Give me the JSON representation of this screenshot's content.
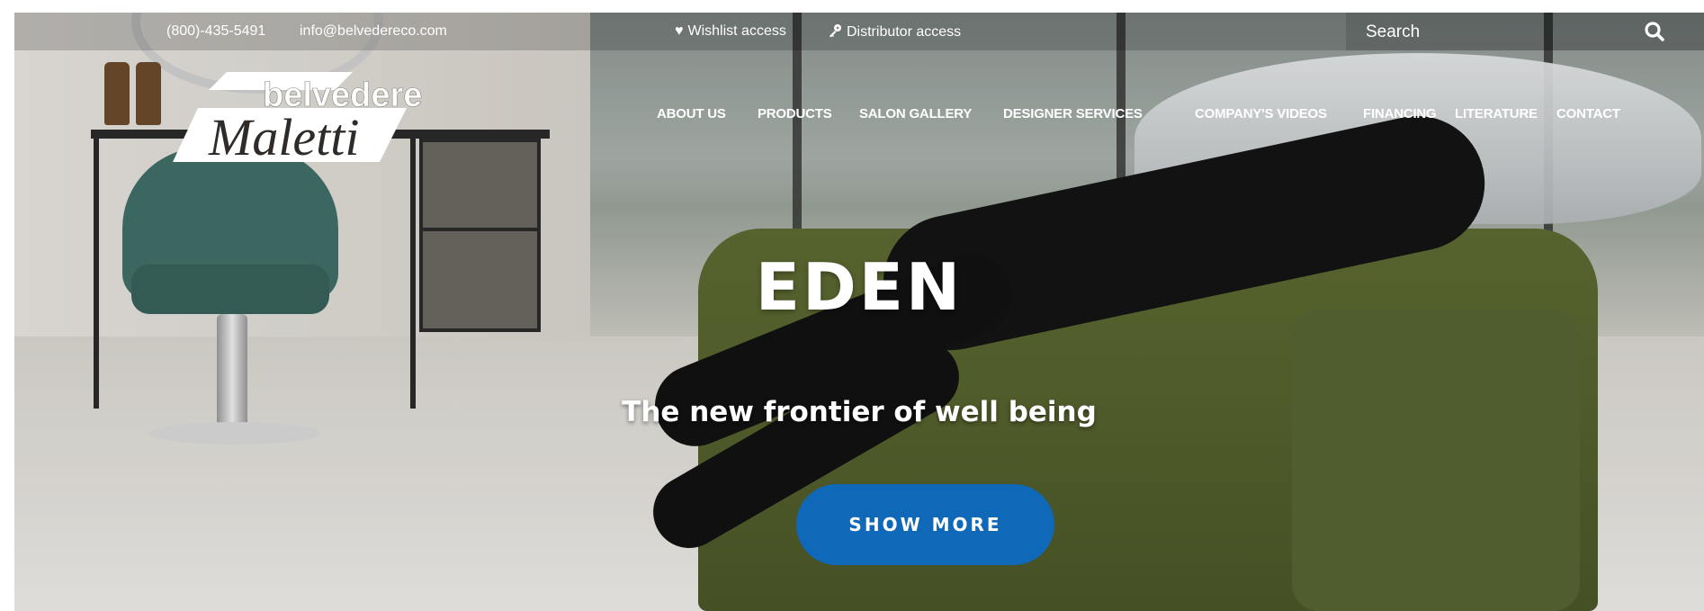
{
  "topbar": {
    "phone": "(800)-435-5491",
    "email": "info@belvedereco.com",
    "wishlist_label": "Wishlist access",
    "distributor_label": "Distributor access",
    "wishlist_icon": "heart-icon",
    "distributor_icon": "key-icon"
  },
  "search": {
    "placeholder": "Search",
    "icon": "search-icon"
  },
  "logo": {
    "line1": "belvedere",
    "line2": "Maletti"
  },
  "nav": {
    "items": [
      {
        "label": "ABOUT US"
      },
      {
        "label": "PRODUCTS"
      },
      {
        "label": "SALON GALLERY"
      },
      {
        "label": "DESIGNER SERVICES"
      },
      {
        "label": "COMPANY'S VIDEOS"
      },
      {
        "label": "FINANCING"
      },
      {
        "label": "LITERATURE"
      },
      {
        "label": "CONTACT"
      }
    ]
  },
  "hero": {
    "title": "EDEN",
    "subtitle": "The new frontier of well being",
    "cta_label": "SHOW MORE",
    "cta_color": "#0f68b8"
  }
}
